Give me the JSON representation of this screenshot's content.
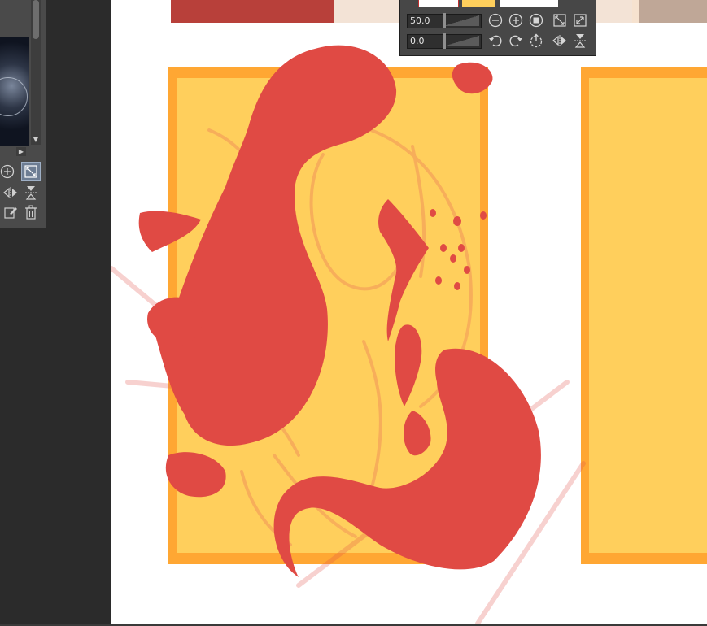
{
  "palette": {
    "zoom_value": "50.0",
    "rotation_value": "0.0"
  },
  "colors": {
    "canvas_bg": "#ffffff",
    "panel_bg": "#474747",
    "frame_orange": "#ffa733",
    "frame_fill": "#ffcf5c",
    "sketch_red": "#e04a44",
    "sketch_lines": "#f6a75a"
  },
  "icons": {
    "zoom_out": "minus-circle-icon",
    "zoom_in": "plus-circle-icon",
    "stop": "stop-circle-icon",
    "fit": "fit-window-icon",
    "actual_size": "expand-icon",
    "rotate_left": "rotate-left-icon",
    "rotate_right": "rotate-right-icon",
    "reset_rotation": "reset-rotation-icon",
    "flip_horizontal": "flip-horizontal-icon",
    "flip_vertical": "flip-vertical-icon"
  }
}
